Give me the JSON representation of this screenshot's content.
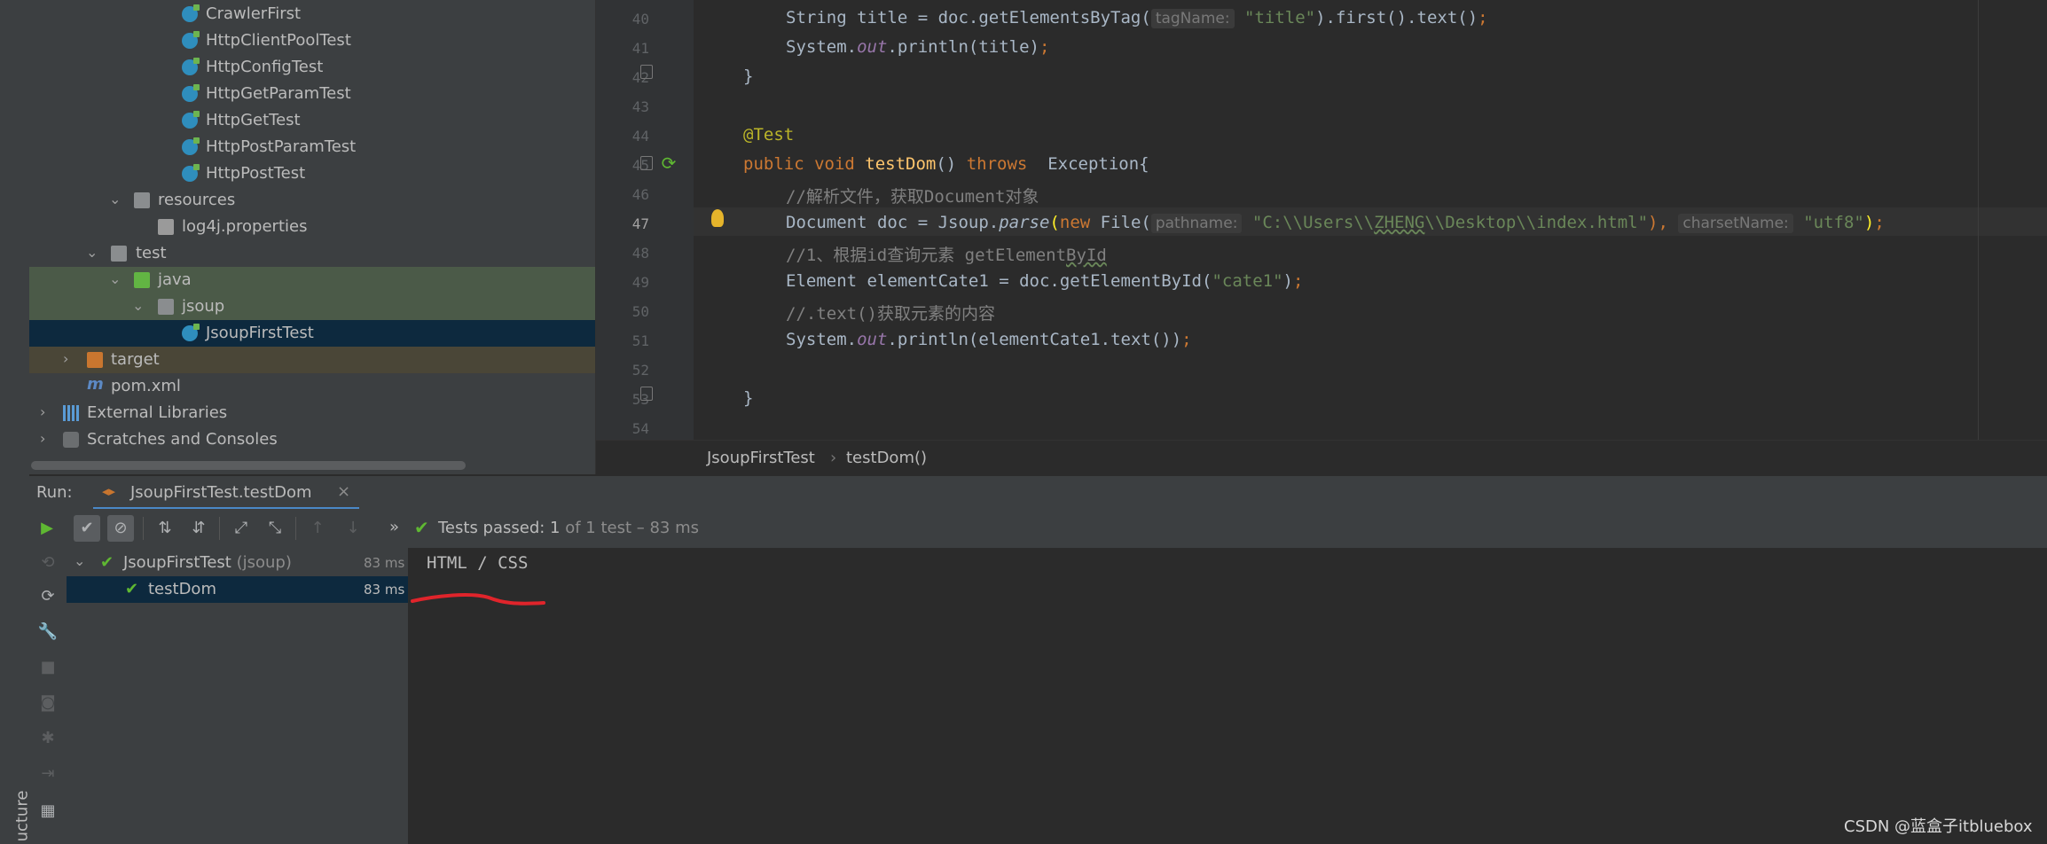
{
  "project_tree": {
    "items": [
      {
        "label": "CrawlerFirst"
      },
      {
        "label": "HttpClientPoolTest"
      },
      {
        "label": "HttpConfigTest"
      },
      {
        "label": "HttpGetParamTest"
      },
      {
        "label": "HttpGetTest"
      },
      {
        "label": "HttpPostParamTest"
      },
      {
        "label": "HttpPostTest"
      },
      {
        "label": "resources"
      },
      {
        "label": "log4j.properties"
      },
      {
        "label": "test"
      },
      {
        "label": "java"
      },
      {
        "label": "jsoup"
      },
      {
        "label": "JsoupFirstTest"
      },
      {
        "label": "target"
      },
      {
        "label": "pom.xml"
      },
      {
        "label": "External Libraries"
      },
      {
        "label": "Scratches and Consoles"
      }
    ]
  },
  "editor": {
    "line_numbers": [
      "40",
      "41",
      "42",
      "43",
      "44",
      "45",
      "46",
      "47",
      "48",
      "49",
      "50",
      "51",
      "52",
      "53",
      "54"
    ],
    "hints": {
      "tag_name": "tagName:",
      "pathname": "pathname:",
      "charset_name": "charsetName:"
    },
    "l40": {
      "a": "String title = doc.getElementsByTag(",
      "s": "\"title\"",
      "b": ").first().text()",
      "c": ";"
    },
    "l41": {
      "a": "System.",
      "b": "out",
      "c": ".println(title)",
      "d": ";"
    },
    "l42": "}",
    "l44": "@Test",
    "l45": {
      "kw1": "public void ",
      "fn": "testDom",
      "a": "() ",
      "kw2": "throws",
      "b": "  Exception{"
    },
    "l46": "//解析文件，获取Document对象",
    "l47": {
      "a": "Document doc = Jsoup.",
      "b": "parse",
      "c": "(",
      "kw": "new ",
      "d": "File(",
      "s1": "\"C:\\\\Users\\\\",
      "s2": "ZHENG",
      "s3": "\\\\Desktop\\\\index.html\"",
      "e": "), ",
      "s4": "\"utf8\"",
      "f": ")",
      "g": ";"
    },
    "l48": {
      "a": "//1、根据id查询元素 getElement",
      "b": "ById"
    },
    "l49": {
      "a": "Element elementCate1 = doc.getElementById(",
      "s": "\"cate1\"",
      "b": ")",
      "c": ";"
    },
    "l50": "//.text()获取元素的内容",
    "l51": {
      "a": "System.",
      "b": "out",
      "c": ".println(elementCate1.text())",
      "d": ";"
    },
    "l53": "}"
  },
  "breadcrumbs": {
    "class": "JsoupFirstTest",
    "sep": "›",
    "method": "testDom()"
  },
  "run": {
    "label": "Run:",
    "tab": "JsoupFirstTest.testDom",
    "close": "×",
    "status_prefix": "Tests passed: ",
    "status_count": "1",
    "status_rest": " of 1 test – 83 ms",
    "more": "»",
    "tree": [
      {
        "name": "JsoupFirstTest",
        "pkg": "(jsoup)",
        "time": "83 ms"
      },
      {
        "name": "testDom",
        "time": "83 ms"
      }
    ],
    "console_output": "HTML / CSS"
  },
  "structure_tab": "ucture",
  "watermark": "CSDN @蓝盒子itbluebox",
  "colors": {
    "accent_green": "#5fb832",
    "selection": "#0d293e",
    "annotation_red": "#e0242b"
  }
}
